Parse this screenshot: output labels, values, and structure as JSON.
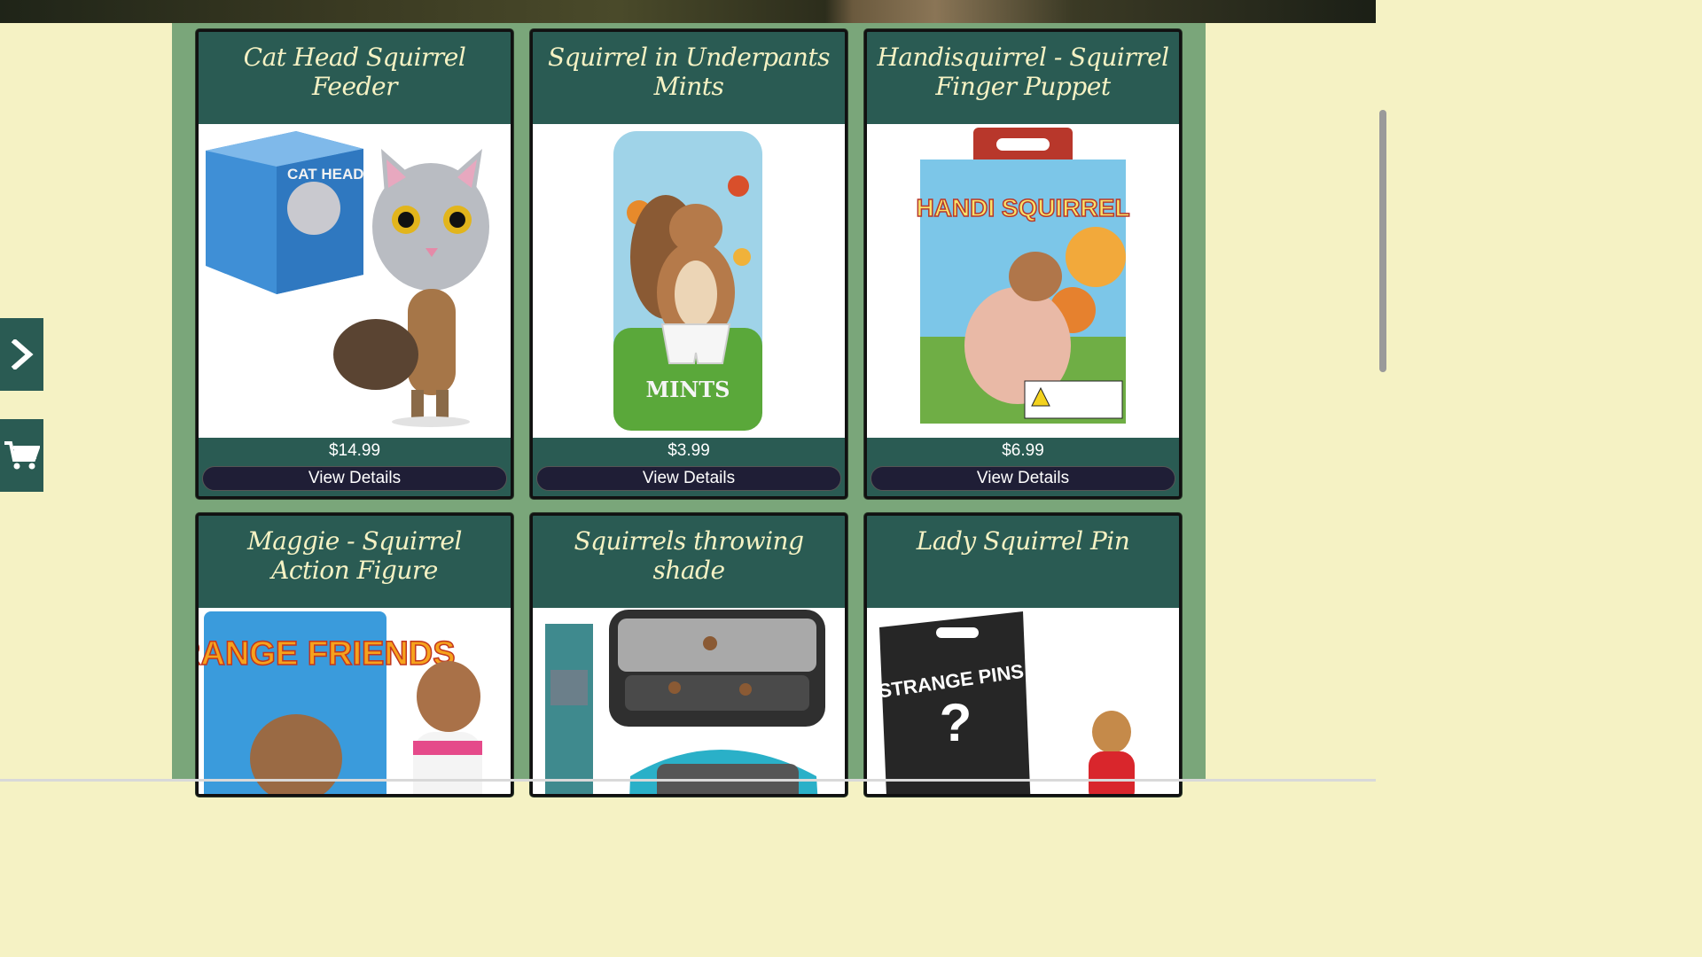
{
  "products": [
    {
      "title": "Cat Head Squirrel Feeder",
      "price": "$14.99",
      "button": "View Details",
      "image": "cat-head-squirrel-feeder",
      "image_text": "CAT HEAD"
    },
    {
      "title": "Squirrel in Underpants Mints",
      "price": "$3.99",
      "button": "View Details",
      "image": "squirrel-underpants-mints",
      "image_text": "MINTS"
    },
    {
      "title": "Handisquirrel - Squirrel Finger Puppet",
      "price": "$6.99",
      "button": "View Details",
      "image": "handi-squirrel-box",
      "image_text": "HANDI SQUIRREL"
    },
    {
      "title": "Maggie - Squirrel Action Figure",
      "price": "",
      "button": "",
      "image": "strange-friends-figure",
      "image_text": "STRANGE FRIENDS"
    },
    {
      "title": "Squirrels throwing shade",
      "price": "",
      "button": "",
      "image": "squirrel-car-shade",
      "image_text": ""
    },
    {
      "title": "Lady Squirrel Pin",
      "price": "",
      "button": "",
      "image": "strange-pins-card",
      "image_text": "STRANGE PINS"
    }
  ],
  "sidebar": {
    "expand_icon": "chevron-right-icon",
    "cart_icon": "shopping-cart-icon"
  },
  "colors": {
    "page_bg": "#f5f2c4",
    "content_bg": "#7aa67a",
    "card_bg": "#2a5b53",
    "button_bg": "#1f1e36",
    "title_text": "#f5f2c4"
  }
}
